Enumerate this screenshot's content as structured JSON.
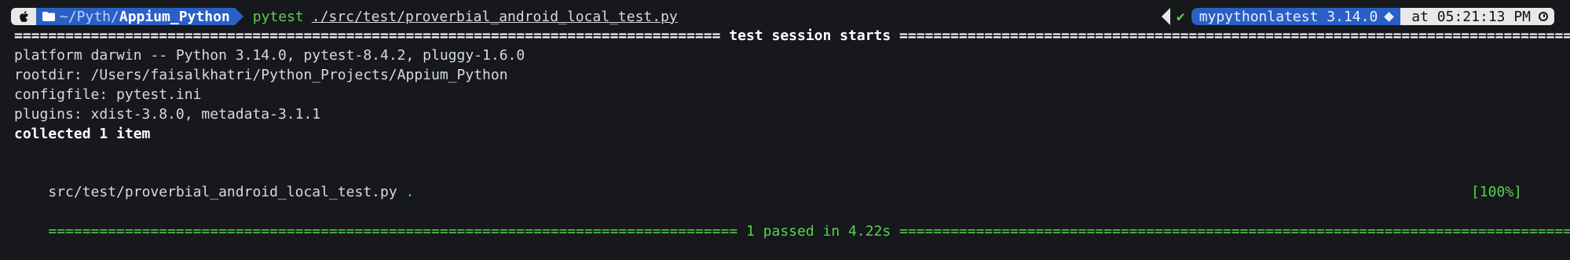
{
  "prompt": {
    "dir_prefix": "~/Pyth/",
    "dir_name": "Appium_Python",
    "command": "pytest",
    "argument": "./src/test/proverbial_android_local_test.py"
  },
  "right_prompt": {
    "env_name": "mypythonlatest 3.14.0",
    "time": "at 05:21:13 PM"
  },
  "output": {
    "session_header": "=================================================================================== test session starts ===================================================================================",
    "platform": "platform darwin -- Python 3.14.0, pytest-8.4.2, pluggy-1.6.0",
    "rootdir": "rootdir: /Users/faisalkhatri/Python_Projects/Appium_Python",
    "configfile": "configfile: pytest.ini",
    "plugins": "plugins: xdist-3.8.0, metadata-3.1.1",
    "collected": "collected 1 item",
    "test_file": "src/test/proverbial_android_local_test.py",
    "test_result": ".",
    "progress": "[100%]",
    "summary": "================================================================================= 1 passed in 4.22s ================================================================================="
  },
  "colors": {
    "background": "#16181c",
    "accent_blue": "#2a5fc4",
    "pass_green": "#59d14f"
  },
  "icons": [
    "apple-icon",
    "folder-icon",
    "check-icon",
    "diamond-icon",
    "clock-icon"
  ]
}
